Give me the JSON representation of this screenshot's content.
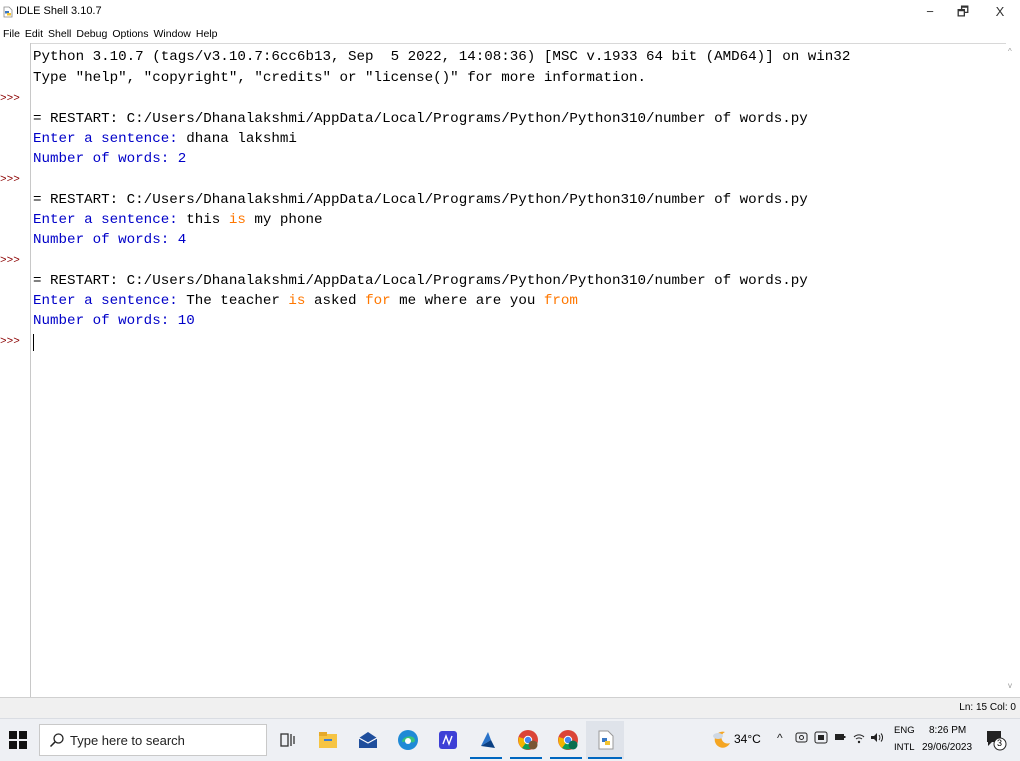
{
  "window": {
    "title": "IDLE Shell 3.10.7",
    "minimize_glyph": "−",
    "maximize_glyph": "🗗",
    "close_glyph": "X"
  },
  "menu": [
    "File",
    "Edit",
    "Shell",
    "Debug",
    "Options",
    "Window",
    "Help"
  ],
  "shell": {
    "banner_line1": "Python 3.10.7 (tags/v3.10.7:6cc6b13, Sep  5 2022, 14:08:36) [MSC v.1933 64 bit (AMD64)] on win32",
    "banner_line2": "Type \"help\", \"copyright\", \"credits\" or \"license()\" for more information.",
    "prompt": ">>>",
    "restart_line": "= RESTART: C:/Users/Dhanalakshmi/AppData/Local/Programs/Python/Python310/number of words.py",
    "input_prompt": "Enter a sentence: ",
    "run1_input": "dhana lakshmi",
    "run1_output": "Number of words: 2",
    "run2_input_parts": [
      "this ",
      "is",
      " my phone"
    ],
    "run2_output": "Number of words: 4",
    "run3_input_parts": [
      "The teacher ",
      "is",
      " asked ",
      "for",
      " me where are you ",
      "from"
    ],
    "run3_output": "Number of words: 10"
  },
  "status": {
    "position": "Ln: 15  Col: 0"
  },
  "taskbar": {
    "search_placeholder": "Type here to search",
    "temperature": "34°C",
    "lang_top": "ENG",
    "lang_bottom": "INTL",
    "time": "8:26 PM",
    "date": "29/06/2023",
    "notification_count": "3"
  }
}
